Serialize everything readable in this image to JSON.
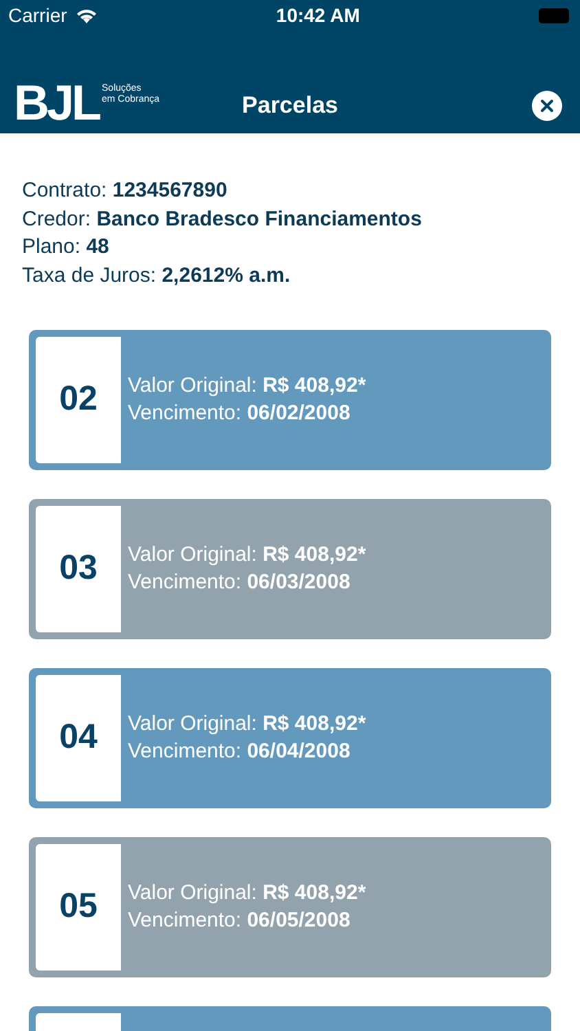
{
  "status_bar": {
    "carrier": "Carrier",
    "time": "10:42 AM"
  },
  "nav": {
    "logo": {
      "letters": "BJL",
      "tagline": [
        "Soluções",
        "em Cobrança"
      ]
    },
    "title": "Parcelas"
  },
  "info": [
    {
      "label": "Contrato: ",
      "value": "1234567890"
    },
    {
      "label": "Credor: ",
      "value": "Banco Bradesco Financiamentos"
    },
    {
      "label": "Plano: ",
      "value": "48"
    },
    {
      "label": "Taxa de Juros: ",
      "value": "2,2612% a.m."
    }
  ],
  "installments": [
    {
      "number": "02",
      "color": "#6399bd",
      "value_label": "Valor Original: ",
      "value": "R$ 408,92*",
      "due_label": "Vencimento: ",
      "due": "06/02/2008"
    },
    {
      "number": "03",
      "color": "#93a3ae",
      "value_label": "Valor Original: ",
      "value": "R$ 408,92*",
      "due_label": "Vencimento: ",
      "due": "06/03/2008"
    },
    {
      "number": "04",
      "color": "#6399bd",
      "value_label": "Valor Original: ",
      "value": "R$ 408,92*",
      "due_label": "Vencimento: ",
      "due": "06/04/2008"
    },
    {
      "number": "05",
      "color": "#93a3ae",
      "value_label": "Valor Original: ",
      "value": "R$ 408,92*",
      "due_label": "Vencimento: ",
      "due": "06/05/2008"
    },
    {
      "color": "#6399bd"
    }
  ]
}
